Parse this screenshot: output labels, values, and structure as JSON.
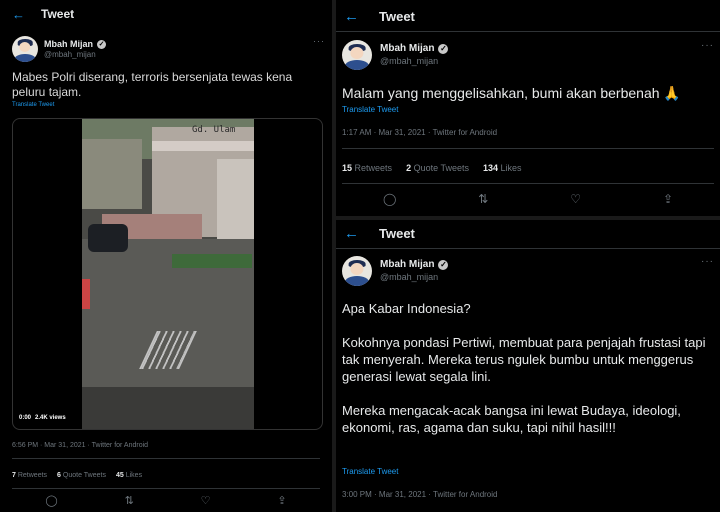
{
  "left": {
    "header": {
      "back_icon": "arrow-left-icon",
      "title": "Tweet"
    },
    "user": {
      "name": "Mbah Mijan",
      "handle": "@mbah_mijan"
    },
    "text": "Mabes Polri diserang, terroris bersenjata tewas kena peluru tajam.",
    "translate": "Translate Tweet",
    "video": {
      "time": "0:00",
      "views": "2.4K views",
      "sign": "Gd. Ulam"
    },
    "meta": "6:56 PM · Mar 31, 2021 · Twitter for Android",
    "stats": [
      {
        "value": "7",
        "label": "Retweets"
      },
      {
        "value": "6",
        "label": "Quote Tweets"
      },
      {
        "value": "45",
        "label": "Likes"
      }
    ],
    "actions": [
      "reply-icon",
      "retweet-icon",
      "like-icon",
      "share-icon"
    ]
  },
  "right_top": {
    "header": {
      "back_icon": "arrow-left-icon",
      "title": "Tweet"
    },
    "user": {
      "name": "Mbah Mijan",
      "handle": "@mbah_mijan"
    },
    "text": "Malam yang menggelisahkan, bumi akan berbenah 🙏",
    "translate": "Translate Tweet",
    "meta": "1:17 AM · Mar 31, 2021 · Twitter for Android",
    "stats": [
      {
        "value": "15",
        "label": "Retweets"
      },
      {
        "value": "2",
        "label": "Quote Tweets"
      },
      {
        "value": "134",
        "label": "Likes"
      }
    ],
    "actions": [
      "reply-icon",
      "retweet-icon",
      "like-icon",
      "share-icon"
    ]
  },
  "right_bottom": {
    "header": {
      "back_icon": "arrow-left-icon",
      "title": "Tweet"
    },
    "user": {
      "name": "Mbah Mijan",
      "handle": "@mbah_mijan"
    },
    "paragraphs": [
      "Apa Kabar Indonesia?",
      "Kokohnya pondasi Pertiwi, membuat para penjajah frustasi tapi tak menyerah. Mereka terus ngulek bumbu untuk menggerus generasi lewat segala lini.",
      "Mereka mengacak-acak bangsa ini lewat Budaya, ideologi, ekonomi, ras, agama dan suku, tapi nihil hasil!!!"
    ],
    "translate": "Translate Tweet",
    "meta": "3:00 PM · Mar 31, 2021 · Twitter for Android"
  },
  "colors": {
    "background": "#000000",
    "accent": "#1d9bf0",
    "muted": "#6e767d",
    "border": "#2f3336"
  }
}
